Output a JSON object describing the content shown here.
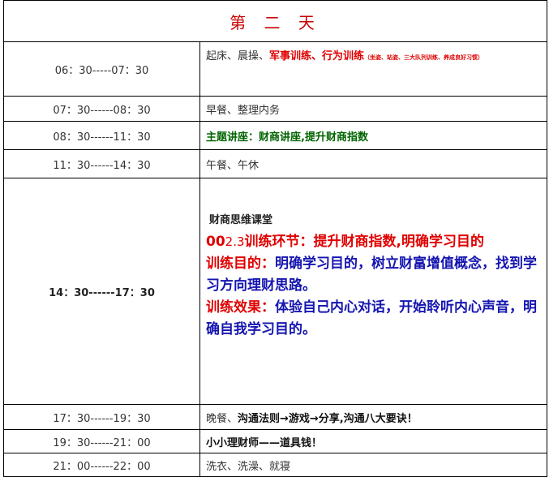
{
  "title": "第 二 天",
  "rows": [
    {
      "time": "06：30-----07：30",
      "activity_normal": "起床、晨操、",
      "activity_highlight": "军事训练、行为训练",
      "activity_note": "（坐姿、站姿、三大队列训练、养成良好习惯）"
    },
    {
      "time": "07：30------08：30",
      "activity": "早餐、整理内务"
    },
    {
      "time": "08：30------11：30",
      "activity": "主题讲座：财商讲座,提升财商指数"
    },
    {
      "time": "11：30------14：30",
      "activity": "午餐、午休"
    },
    {
      "time": "14：30------17：30",
      "heading": "财商思维课堂",
      "line1_prefix": "00",
      "line1_code": "2.3",
      "line1_rest": "训练环节：提升财商指数,明确学习目的",
      "line2_label": "训练目的：",
      "line2_text": "明确学习目的，树立财富增值概念，找到学习方向理财思路。",
      "line3_label": "训练效果：",
      "line3_text": "体验自己内心对话，开始聆听内心声音，明确自我学习目的。"
    },
    {
      "time": "17：30------19：30",
      "activity_normal": "晚餐、",
      "activity_bold": "沟通法则→游戏→分享,沟通八大要诀！"
    },
    {
      "time": "19：30------21：00",
      "activity": "小小理财师——道具钱！"
    },
    {
      "time": "21：00------22：00",
      "activity": "洗衣、洗澡、就寝"
    }
  ],
  "colors": {
    "title": "#cc0000",
    "highlight_red": "#e00000",
    "highlight_green": "#006400",
    "highlight_blue": "#1515b0"
  }
}
